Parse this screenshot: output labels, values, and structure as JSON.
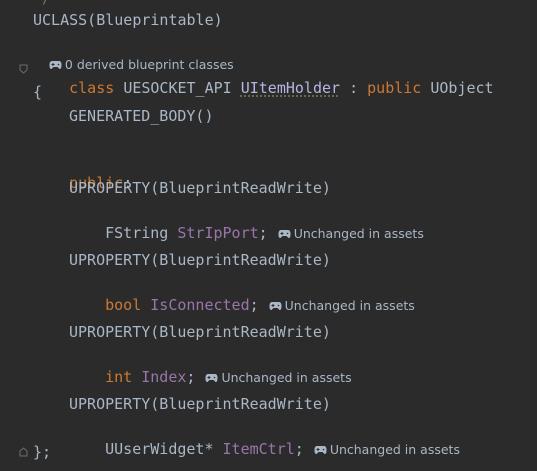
{
  "editor": {
    "lines": {
      "top_cut": "*/",
      "uclass": "UCLASS(Blueprintable)",
      "derived_hint": "0 derived blueprint classes",
      "class_kw": "class",
      "api_macro": "UESOCKET_API",
      "class_name": "UItemHolder",
      "colon": " : ",
      "public_kw": "public",
      "base_class": "UObject",
      "open_brace": "{",
      "generated_body": "GENERATED_BODY()",
      "public_label": "public",
      "public_colon": ":",
      "close_brace": "};"
    },
    "properties": [
      {
        "macro": "UPROPERTY(BlueprintReadWrite)",
        "type": "FString",
        "name": "StrIpPort",
        "semicolon": ";",
        "hint": "Unchanged in assets"
      },
      {
        "macro": "UPROPERTY(BlueprintReadWrite)",
        "type": "bool",
        "name": "IsConnected",
        "semicolon": ";",
        "hint": "Unchanged in assets"
      },
      {
        "macro": "UPROPERTY(BlueprintReadWrite)",
        "type": "int",
        "name": "Index",
        "semicolon": ";",
        "hint": "Unchanged in assets"
      },
      {
        "macro": "UPROPERTY(BlueprintReadWrite)",
        "type": "UUserWidget*",
        "name": "ItemCtrl",
        "semicolon": ";",
        "hint": "Unchanged in assets"
      }
    ]
  },
  "colors": {
    "background": "#2b2b2b",
    "keyword": "#cc7832",
    "default_text": "#a9b7c6",
    "field": "#9876aa",
    "class_name": "#b5b6e3"
  },
  "icons": {
    "hint_icon": "gamepad-icon",
    "fold_icon": "fold-marker-icon"
  }
}
